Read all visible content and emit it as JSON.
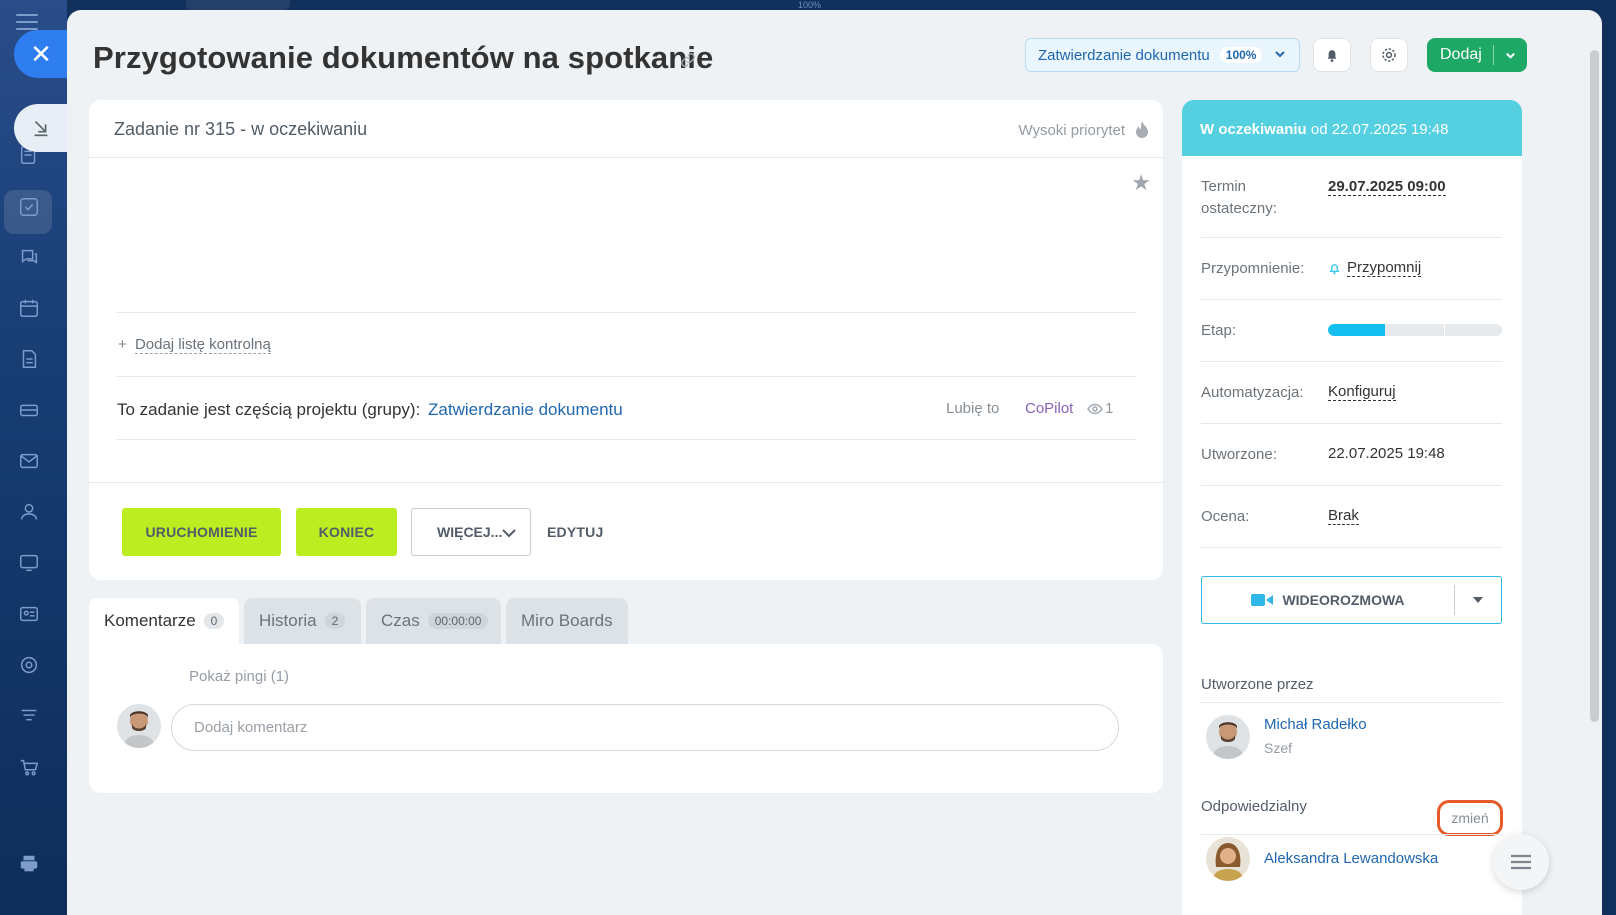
{
  "top": {
    "zoom": "100%"
  },
  "header": {
    "title": "Przygotowanie dokumentów na spotkanie",
    "project_pill": "Zatwierdzanie dokumentu",
    "project_pct": "100%",
    "add_label": "Dodaj"
  },
  "task": {
    "number_status": "Zadanie nr 315 - w oczekiwaniu",
    "priority": "Wysoki priorytet",
    "add_checklist_plus": "+",
    "add_checklist": "Dodaj listę kontrolną",
    "project_prefix": "To zadanie jest częścią projektu (grupy):",
    "project_link": "Zatwierdzanie dokumentu",
    "like": "Lubię to",
    "copilot": "CoPilot",
    "views": "1",
    "buttons": {
      "start": "URUCHOMIENIE",
      "finish": "KONIEC",
      "more": "WIĘCEJ...",
      "edit": "EDYTUJ"
    }
  },
  "tabs": [
    {
      "label": "Komentarze",
      "count": "0"
    },
    {
      "label": "Historia",
      "count": "2"
    },
    {
      "label": "Czas",
      "count": "00:00:00"
    },
    {
      "label": "Miro Boards"
    }
  ],
  "comments": {
    "pings": "Pokaż pingi (1)",
    "placeholder": "Dodaj komentarz"
  },
  "side": {
    "status_bold": "W oczekiwaniu",
    "status_rest": " od 22.07.2025 19:48",
    "deadline_label_1": "Termin",
    "deadline_label_2": "ostateczny:",
    "deadline_value": "29.07.2025 09:00",
    "reminder_label": "Przypomnienie:",
    "reminder_value": "Przypomnij",
    "stage_label": "Etap:",
    "stage_progress": 0.33,
    "automation_label": "Automatyzacja:",
    "automation_value": "Konfiguruj",
    "created_label": "Utworzone:",
    "created_value": "22.07.2025 19:48",
    "rating_label": "Ocena:",
    "rating_value": "Brak",
    "video_label": "WIDEOROZMOWA",
    "created_by_title": "Utworzone przez",
    "creator_name": "Michał Radełko",
    "creator_role": "Szef",
    "responsible_title": "Odpowiedzialny",
    "change_label": "zmień",
    "responsible_name": "Aleksandra Lewandowska"
  },
  "colors": {
    "accent": "#2067b0",
    "green_btn": "#bbed21",
    "status_head": "#55d0e0",
    "add_btn": "#1ea865",
    "highlight": "#e65a2a"
  }
}
